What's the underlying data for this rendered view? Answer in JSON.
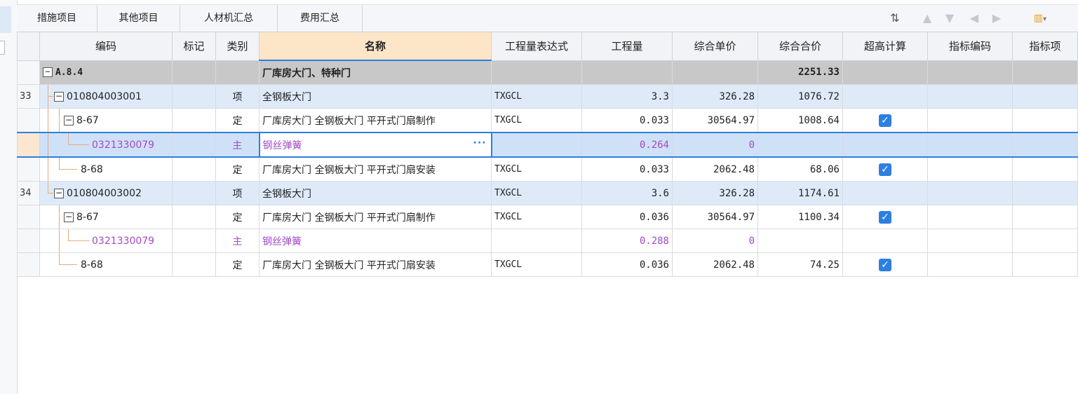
{
  "tabs": [
    "措施项目",
    "其他项目",
    "人材机汇总",
    "费用汇总"
  ],
  "toolbar": {
    "sort_icon": "sort-icon",
    "up_icon": "arrow-up-icon",
    "down_icon": "arrow-down-icon",
    "left_icon": "arrow-left-icon",
    "right_icon": "arrow-right-icon",
    "settings_icon": "column-settings-icon"
  },
  "columns": [
    "编码",
    "标记",
    "类别",
    "名称",
    "工程量表达式",
    "工程量",
    "综合单价",
    "综合合价",
    "超高计算",
    "指标编码",
    "指标项"
  ],
  "rows": [
    {
      "rownum": "",
      "code": "A.8.4",
      "mark": "",
      "type": "",
      "name": "厂库房大门、特种门",
      "expr": "",
      "qty": "",
      "unit_price": "",
      "total": "2251.33",
      "chaogao": false
    },
    {
      "rownum": "33",
      "code": "010804003001",
      "mark": "",
      "type": "项",
      "name": "全钢板大门",
      "expr": "TXGCL",
      "qty": "3.3",
      "unit_price": "326.28",
      "total": "1076.72",
      "chaogao": false
    },
    {
      "rownum": "",
      "code": "8-67",
      "mark": "",
      "type": "定",
      "name": "厂库房大门 全钢板大门 平开式门扇制作",
      "expr": "TXGCL",
      "qty": "0.033",
      "unit_price": "30564.97",
      "total": "1008.64",
      "chaogao": true
    },
    {
      "rownum": "",
      "code": "0321330079",
      "mark": "",
      "type": "主",
      "name": "钢丝弹簧",
      "expr": "",
      "qty": "0.264",
      "unit_price": "0",
      "total": "",
      "chaogao": false
    },
    {
      "rownum": "",
      "code": "8-68",
      "mark": "",
      "type": "定",
      "name": "厂库房大门 全钢板大门 平开式门扇安装",
      "expr": "TXGCL",
      "qty": "0.033",
      "unit_price": "2062.48",
      "total": "68.06",
      "chaogao": true
    },
    {
      "rownum": "34",
      "code": "010804003002",
      "mark": "",
      "type": "项",
      "name": "全钢板大门",
      "expr": "TXGCL",
      "qty": "3.6",
      "unit_price": "326.28",
      "total": "1174.61",
      "chaogao": false
    },
    {
      "rownum": "",
      "code": "8-67",
      "mark": "",
      "type": "定",
      "name": "厂库房大门 全钢板大门 平开式门扇制作",
      "expr": "TXGCL",
      "qty": "0.036",
      "unit_price": "30564.97",
      "total": "1100.34",
      "chaogao": true
    },
    {
      "rownum": "",
      "code": "0321330079",
      "mark": "",
      "type": "主",
      "name": "钢丝弹簧",
      "expr": "",
      "qty": "0.288",
      "unit_price": "0",
      "total": "",
      "chaogao": false
    },
    {
      "rownum": "",
      "code": "8-68",
      "mark": "",
      "type": "定",
      "name": "厂库房大门 全钢板大门 平开式门扇安装",
      "expr": "TXGCL",
      "qty": "0.036",
      "unit_price": "2062.48",
      "total": "74.25",
      "chaogao": true
    }
  ],
  "colors": {
    "accent": "#2d7fe0",
    "group_bg": "#c8c8c8",
    "item_bg": "#dfeaf9",
    "material_text": "#a24ac7",
    "tree_line": "#e8a97a"
  }
}
